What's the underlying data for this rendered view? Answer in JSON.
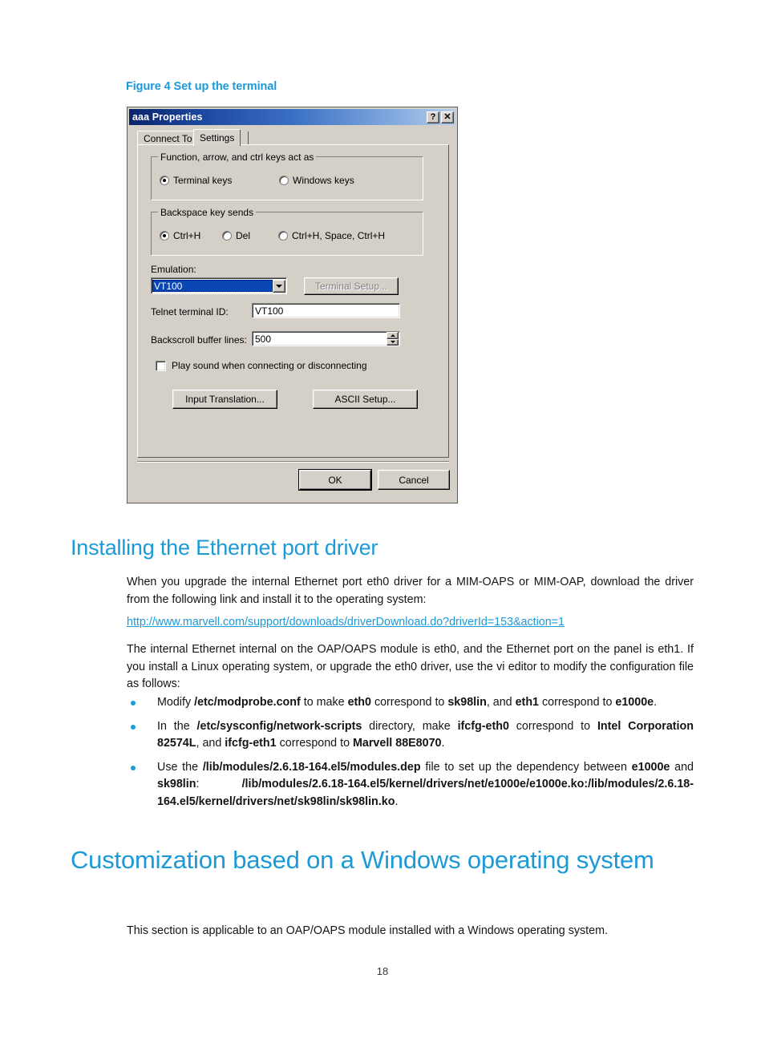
{
  "page": {
    "number": "18"
  },
  "figure": {
    "caption": "Figure 4 Set up the terminal",
    "caption_color": "#1B9AD7"
  },
  "dialog": {
    "title": "aaa Properties",
    "titlebar_buttons": [
      {
        "name": "help-button",
        "glyph": "?"
      },
      {
        "name": "close-button",
        "glyph": "✕"
      }
    ],
    "tabs": [
      {
        "label": "Connect To",
        "active": false
      },
      {
        "label": "Settings",
        "active": true
      }
    ],
    "group_function_keys": {
      "label": "Function, arrow, and ctrl keys act as",
      "options": [
        {
          "label": "Terminal keys",
          "selected": true
        },
        {
          "label": "Windows keys",
          "selected": false
        }
      ]
    },
    "group_backspace": {
      "label": "Backspace key sends",
      "options": [
        {
          "label": "Ctrl+H",
          "selected": true
        },
        {
          "label": "Del",
          "selected": false
        },
        {
          "label": "Ctrl+H, Space, Ctrl+H",
          "selected": false
        }
      ]
    },
    "emulation": {
      "label": "Emulation:",
      "value": "VT100",
      "terminal_setup_button": "Terminal Setup...",
      "terminal_setup_disabled": true
    },
    "telnet_terminal_id": {
      "label": "Telnet terminal ID:",
      "value": "VT100"
    },
    "backscroll_buffer_lines": {
      "label": "Backscroll buffer lines:",
      "value": "500"
    },
    "play_sound": {
      "label": "Play sound when connecting or disconnecting",
      "checked": false
    },
    "buttons": {
      "input_translation": "Input Translation...",
      "ascii_setup": "ASCII Setup...",
      "ok": "OK",
      "cancel": "Cancel"
    }
  },
  "sections": {
    "heading1": "Installing the Ethernet port driver",
    "paragraph1": "When you upgrade the internal Ethernet port eth0 driver for a MIM-OAPS or MIM-OAP, download the driver from the following link and install it to the operating system:",
    "link": "http://www.marvell.com/support/downloads/driverDownload.do?driverId=153&action=1",
    "paragraph2": "The internal Ethernet internal on the OAP/OAPS module is eth0, and the Ethernet port on the panel is eth1. If you install a Linux operating system, or upgrade the eth0 driver, use the vi editor to modify the configuration file as follows:",
    "bullets": [
      {
        "parts": [
          {
            "text": "Modify ",
            "bold": false
          },
          {
            "text": "/etc/modprobe.conf",
            "bold": true
          },
          {
            "text": " to make ",
            "bold": false
          },
          {
            "text": "eth0",
            "bold": true
          },
          {
            "text": " correspond to ",
            "bold": false
          },
          {
            "text": "sk98lin",
            "bold": true
          },
          {
            "text": ", and ",
            "bold": false
          },
          {
            "text": "eth1",
            "bold": true
          },
          {
            "text": " correspond to ",
            "bold": false
          },
          {
            "text": "e1000e",
            "bold": true
          },
          {
            "text": ".",
            "bold": false
          }
        ]
      },
      {
        "parts": [
          {
            "text": "In the ",
            "bold": false
          },
          {
            "text": "/etc/sysconfig/network-scripts",
            "bold": true
          },
          {
            "text": " directory, make ",
            "bold": false
          },
          {
            "text": "ifcfg-eth0",
            "bold": true
          },
          {
            "text": " correspond to ",
            "bold": false
          },
          {
            "text": "Intel Corporation 82574L",
            "bold": true
          },
          {
            "text": ", and ",
            "bold": false
          },
          {
            "text": "ifcfg-eth1",
            "bold": true
          },
          {
            "text": " correspond to ",
            "bold": false
          },
          {
            "text": "Marvell 88E8070",
            "bold": true
          },
          {
            "text": ".",
            "bold": false
          }
        ]
      },
      {
        "parts": [
          {
            "text": "Use the ",
            "bold": false
          },
          {
            "text": "/lib/modules/2.6.18-164.el5/modules.dep",
            "bold": true
          },
          {
            "text": " file to set up the dependency between ",
            "bold": false
          },
          {
            "text": "e1000e",
            "bold": true
          },
          {
            "text": " and ",
            "bold": false
          },
          {
            "text": "sk98lin",
            "bold": true
          },
          {
            "text": ": ",
            "bold": false
          },
          {
            "text": "/lib/modules/2.6.18-164.el5/kernel/drivers/net/e1000e/e1000e.ko:/lib/modules/2.6.18-164.el5/kernel/drivers/net/sk98lin/sk98lin.ko",
            "bold": true
          },
          {
            "text": ".",
            "bold": false
          }
        ]
      }
    ],
    "heading2": "Customization based on a Windows operating system",
    "paragraph3": "This section is applicable to an OAP/OAPS module installed with a Windows operating system."
  }
}
